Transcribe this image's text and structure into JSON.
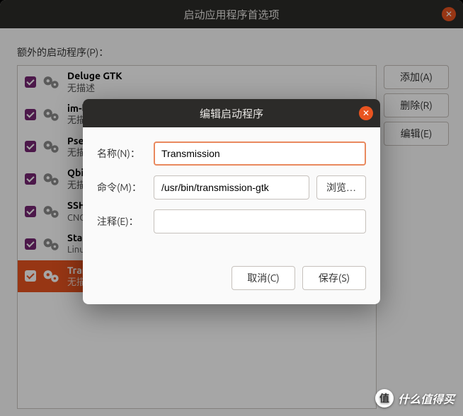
{
  "window": {
    "title": "启动应用程序首选项"
  },
  "section_label": "额外的启动程序(P)：",
  "items": [
    {
      "title": "Deluge GTK",
      "desc": "无描述"
    },
    {
      "title": "im-la",
      "desc": "无描"
    },
    {
      "title": "Psen",
      "desc": "无描"
    },
    {
      "title": "Qbit",
      "desc": "无描"
    },
    {
      "title": "SSH",
      "desc": "CNO"
    },
    {
      "title": "Stace",
      "desc": "Linux"
    },
    {
      "title": "Trans",
      "desc": "无描"
    }
  ],
  "side": {
    "add": "添加(A)",
    "remove": "删除(R)",
    "edit": "编辑(E)"
  },
  "dialog": {
    "title": "编辑启动程序",
    "labels": {
      "name": "名称(N)：",
      "command": "命令(M)：",
      "comment": "注释(E)："
    },
    "values": {
      "name": "Transmission",
      "command": "/usr/bin/transmission-gtk",
      "comment": ""
    },
    "browse": "浏览…",
    "cancel": "取消(C)",
    "save": "保存(S)"
  },
  "watermark": "什么值得买"
}
